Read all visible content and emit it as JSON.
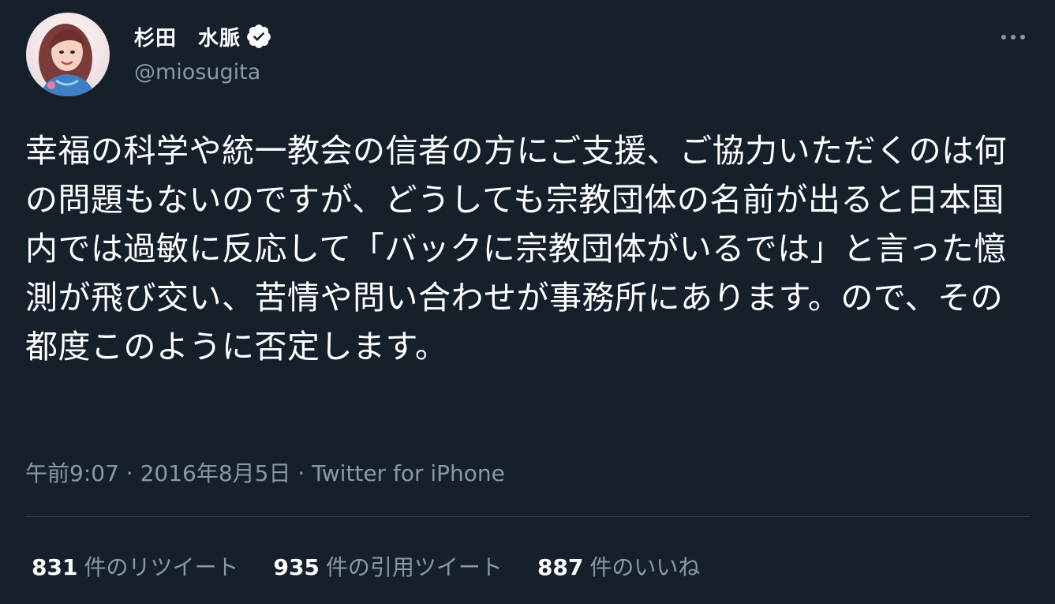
{
  "user": {
    "display_name": "杉田　水脈",
    "handle": "@miosugita",
    "verified": true
  },
  "tweet": {
    "text": "幸福の科学や統一教会の信者の方にご支援、ご協力いただくのは何の問題もないのですが、どうしても宗教団体の名前が出ると日本国内では過敏に反応して「バックに宗教団体がいるでは」と言った憶測が飛び交い、苦情や問い合わせが事務所にあります。ので、その都度このように否定します。",
    "time": "午前9:07",
    "date": "2016年8月5日",
    "source": "Twitter for iPhone",
    "separator": "·"
  },
  "stats": {
    "retweets": {
      "count": "831",
      "label": "件のリツイート"
    },
    "quotes": {
      "count": "935",
      "label": "件の引用ツイート"
    },
    "likes": {
      "count": "887",
      "label": "件のいいね"
    }
  },
  "icons": {
    "verified": "verified-badge-icon",
    "more": "more-horizontal-icon"
  },
  "colors": {
    "background": "#15202b",
    "text_primary": "#ffffff",
    "text_secondary": "#8b98a5",
    "divider": "#38444d"
  }
}
